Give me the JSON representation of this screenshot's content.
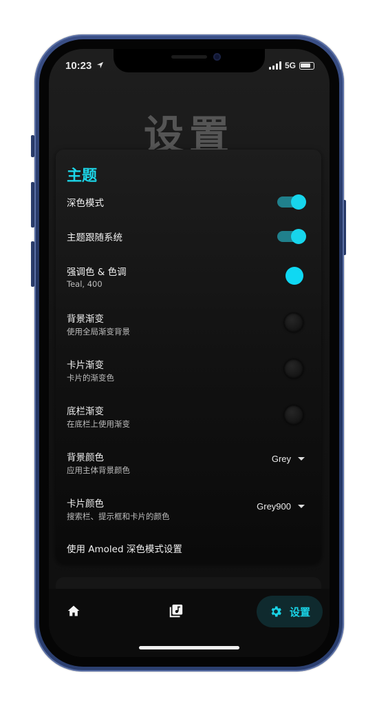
{
  "status_bar": {
    "time": "10:23",
    "network": "5G"
  },
  "page": {
    "title": "设置"
  },
  "theme_card": {
    "title": "主题",
    "accent_color": "#17d5ec",
    "settings": [
      {
        "title": "深色模式",
        "subtitle": "",
        "control": "switch",
        "value": true
      },
      {
        "title": "主题跟随系统",
        "subtitle": "",
        "control": "switch",
        "value": true
      },
      {
        "title": "强调色 & 色调",
        "subtitle": "Teal, 400",
        "control": "color-dot",
        "value": "#0fd8f3"
      },
      {
        "title": "背景渐变",
        "subtitle": "使用全局渐变背景",
        "control": "radio",
        "value": false
      },
      {
        "title": "卡片渐变",
        "subtitle": "卡片的渐变色",
        "control": "radio",
        "value": false
      },
      {
        "title": "底栏渐变",
        "subtitle": "在底栏上使用渐变",
        "control": "radio",
        "value": false
      },
      {
        "title": "背景颜色",
        "subtitle": "应用主体背景颜色",
        "control": "dropdown",
        "value": "Grey"
      },
      {
        "title": "卡片颜色",
        "subtitle": "搜索栏、提示框和卡片的颜色",
        "control": "dropdown",
        "value": "Grey900"
      },
      {
        "title": "使用 Amoled 深色模式设置",
        "subtitle": "",
        "control": "none"
      }
    ]
  },
  "bottom_nav": {
    "items": [
      {
        "icon": "home-icon",
        "label": ""
      },
      {
        "icon": "music-library-icon",
        "label": ""
      },
      {
        "icon": "gear-icon",
        "label": "设置",
        "active": true
      }
    ]
  }
}
